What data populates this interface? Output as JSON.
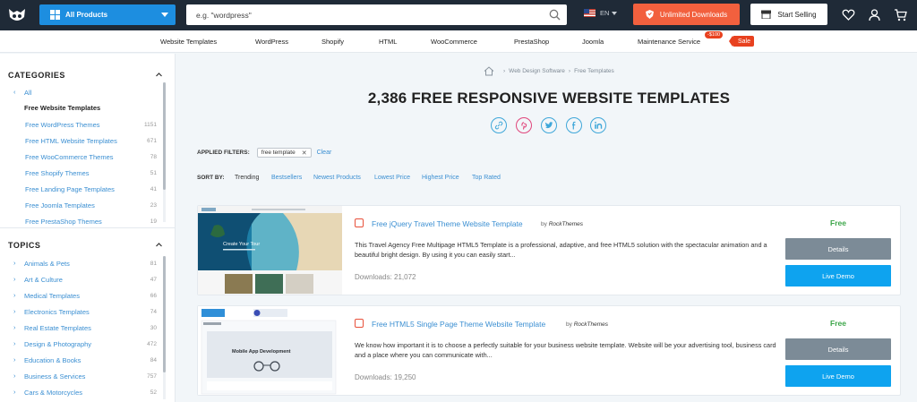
{
  "header": {
    "all_products": "All Products",
    "search_placeholder": "e.g. \"wordpress\"",
    "language": "EN",
    "unlimited_downloads": "Unlimited Downloads",
    "start_selling": "Start Selling"
  },
  "nav": {
    "items": [
      "Website Templates",
      "WordPress",
      "Shopify",
      "HTML",
      "WooCommerce",
      "PrestaShop",
      "Joomla",
      "Maintenance Service"
    ],
    "price_badge": "-$100",
    "sale_badge": "Sale"
  },
  "sidebar": {
    "categories_heading": "CATEGORIES",
    "all_label": "All",
    "current": "Free Website Templates",
    "categories": [
      {
        "label": "Free WordPress Themes",
        "count": "1151"
      },
      {
        "label": "Free HTML Website Templates",
        "count": "671"
      },
      {
        "label": "Free WooCommerce Themes",
        "count": "78"
      },
      {
        "label": "Free Shopify Themes",
        "count": "51"
      },
      {
        "label": "Free Landing Page Templates",
        "count": "41"
      },
      {
        "label": "Free Joomla Templates",
        "count": "23"
      },
      {
        "label": "Free PrestaShop Themes",
        "count": "19"
      }
    ],
    "topics_heading": "TOPICS",
    "topics": [
      {
        "label": "Animals & Pets",
        "count": "81"
      },
      {
        "label": "Art & Culture",
        "count": "47"
      },
      {
        "label": "Medical Templates",
        "count": "66"
      },
      {
        "label": "Electronics Templates",
        "count": "74"
      },
      {
        "label": "Real Estate Templates",
        "count": "30"
      },
      {
        "label": "Design & Photography",
        "count": "472"
      },
      {
        "label": "Education & Books",
        "count": "84"
      },
      {
        "label": "Business & Services",
        "count": "757"
      },
      {
        "label": "Cars & Motorcycles",
        "count": "52"
      }
    ]
  },
  "main": {
    "breadcrumb": [
      "Web Design Software",
      "Free Templates"
    ],
    "title": "2,386 FREE RESPONSIVE WEBSITE TEMPLATES",
    "filters_label": "APPLIED FILTERS:",
    "filter_chip": "free template",
    "clear": "Clear",
    "sort_label": "SORT BY:",
    "sort_options": [
      "Trending",
      "Bestsellers",
      "Newest Products",
      "Lowest Price",
      "Highest Price",
      "Top Rated"
    ],
    "products": [
      {
        "title": "Free jQuery Travel Theme Website Template",
        "by": "by",
        "author": "RockThemes",
        "description": "This Travel Agency Free Multipage HTML5 Template is a professional, adaptive, and free HTML5 solution with the spectacular animation and a beautiful bright design. By using it you can easily start...",
        "downloads": "Downloads: 21,072",
        "price": "Free",
        "details": "Details",
        "demo": "Live Demo",
        "thumb_caption": "Create Your Tour"
      },
      {
        "title": "Free HTML5 Single Page Theme Website Template",
        "by": "by",
        "author": "RockThemes",
        "description": "We know how important it is to choose a perfectly suitable for your business website template. Website will be your advertising tool, business card and a place where you can communicate with...",
        "downloads": "Downloads: 19,250",
        "price": "Free",
        "details": "Details",
        "demo": "Live Demo",
        "thumb_caption": "Mobile App Development"
      }
    ]
  },
  "colors": {
    "topbar": "#1f2a37",
    "accent_blue": "#1d8ee0",
    "cta_orange": "#f2603e",
    "free_green": "#3ca649",
    "demo_blue": "#0ea3ef"
  }
}
